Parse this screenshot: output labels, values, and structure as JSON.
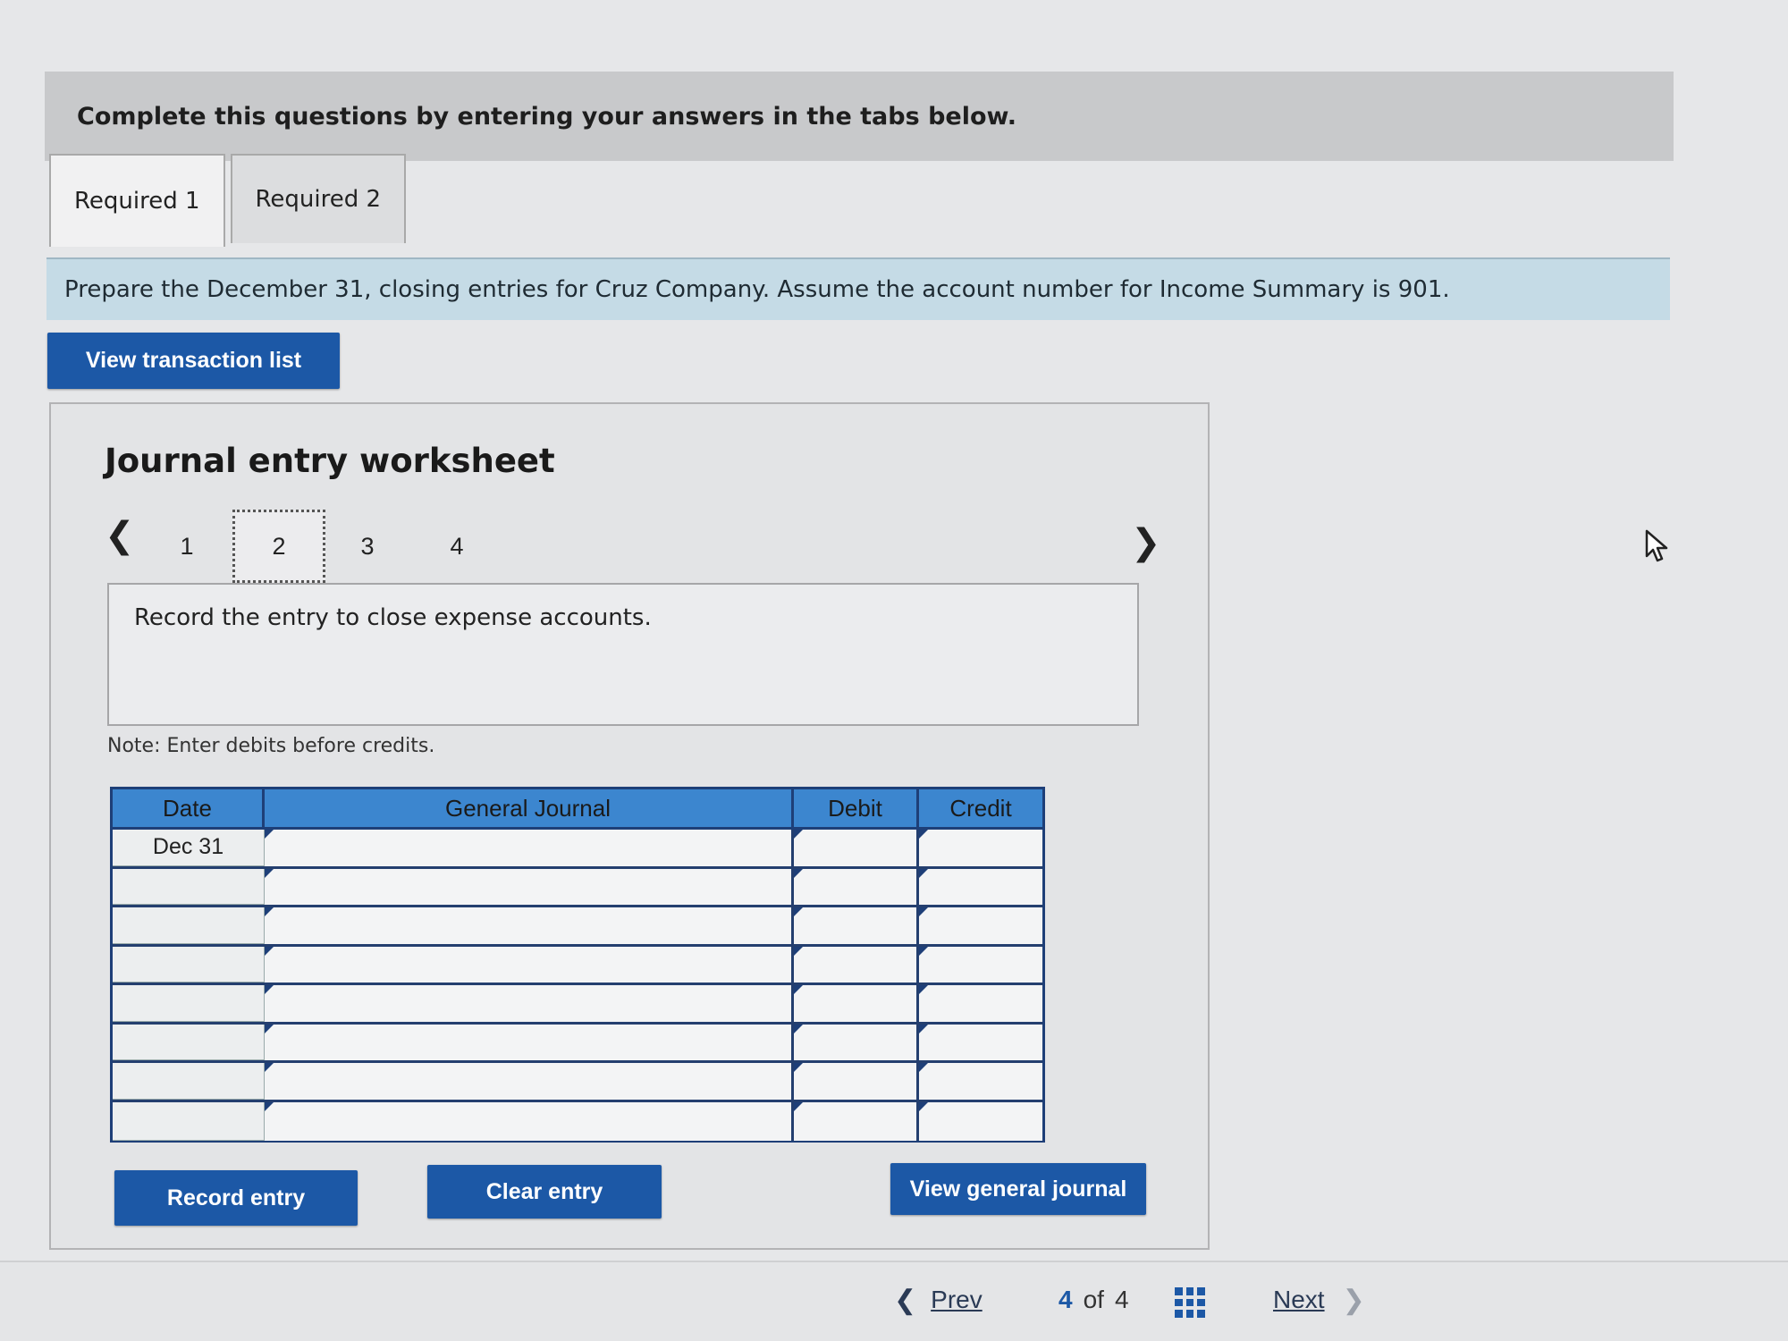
{
  "banner": {
    "text": "Complete this questions by entering your answers in the tabs below."
  },
  "tabs": [
    {
      "label": "Required 1",
      "active": true
    },
    {
      "label": "Required 2",
      "active": false
    }
  ],
  "instructions": "Prepare the December 31, closing entries for Cruz Company. Assume the account number for Income Summary is 901.",
  "view_transaction_button": "View transaction list",
  "worksheet": {
    "title": "Journal entry worksheet",
    "pages": [
      "1",
      "2",
      "3",
      "4"
    ],
    "current_page": "2",
    "prompt": "Record the entry to close expense accounts.",
    "note": "Note: Enter debits before credits.",
    "columns": {
      "date": "Date",
      "general_journal": "General Journal",
      "debit": "Debit",
      "credit": "Credit"
    },
    "rows": [
      {
        "date": "Dec 31",
        "account": "",
        "debit": "",
        "credit": ""
      },
      {
        "date": "",
        "account": "",
        "debit": "",
        "credit": ""
      },
      {
        "date": "",
        "account": "",
        "debit": "",
        "credit": ""
      },
      {
        "date": "",
        "account": "",
        "debit": "",
        "credit": ""
      },
      {
        "date": "",
        "account": "",
        "debit": "",
        "credit": ""
      },
      {
        "date": "",
        "account": "",
        "debit": "",
        "credit": ""
      },
      {
        "date": "",
        "account": "",
        "debit": "",
        "credit": ""
      },
      {
        "date": "",
        "account": "",
        "debit": "",
        "credit": ""
      }
    ],
    "buttons": {
      "record": "Record entry",
      "clear": "Clear entry",
      "view_general_journal": "View general journal"
    }
  },
  "footer": {
    "prev": "Prev",
    "page_current": "4",
    "page_sep": "of",
    "page_total": "4",
    "next": "Next"
  },
  "colors": {
    "accent": "#1c58a6",
    "header_blue": "#3c86cf",
    "instruction_bg": "#c5dbe6"
  }
}
